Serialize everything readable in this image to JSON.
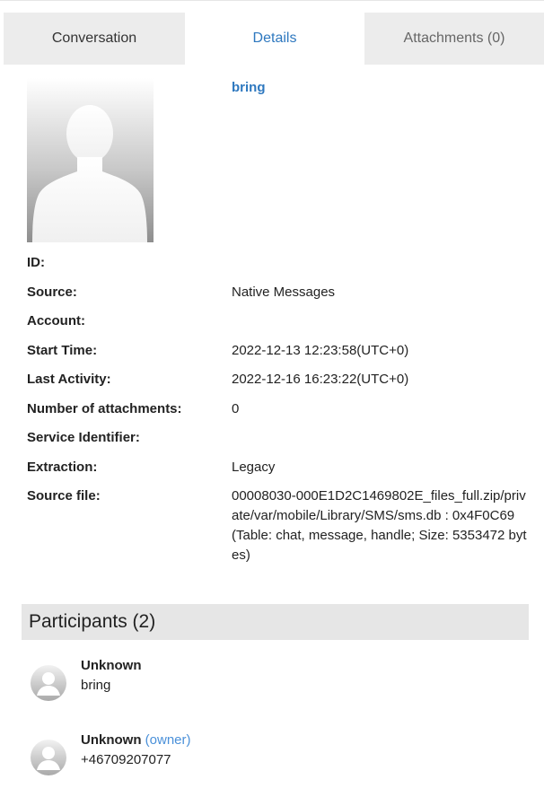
{
  "tabs": {
    "conversation": "Conversation",
    "details": "Details",
    "attachments": "Attachments (0)"
  },
  "conversation_title": "bring",
  "details": [
    {
      "label": "ID:",
      "value": ""
    },
    {
      "label": "Source:",
      "value": "Native Messages"
    },
    {
      "label": "Account:",
      "value": ""
    },
    {
      "label": "Start Time:",
      "value": "2022-12-13 12:23:58(UTC+0)"
    },
    {
      "label": "Last Activity:",
      "value": "2022-12-16 16:23:22(UTC+0)"
    },
    {
      "label": "Number of attachments:",
      "value": "0"
    },
    {
      "label": "Service Identifier:",
      "value": ""
    },
    {
      "label": "Extraction:",
      "value": "Legacy"
    },
    {
      "label": "Source file:",
      "value": "00008030-000E1D2C1469802E_files_full.zip/private/var/mobile/Library/SMS/sms.db : 0x4F0C69 (Table: chat, message, handle; Size: 5353472 bytes)"
    }
  ],
  "participants": {
    "header": "Participants (2)",
    "items": [
      {
        "name": "Unknown",
        "role": "",
        "identifier": "bring"
      },
      {
        "name": "Unknown",
        "role": "(owner)",
        "identifier": "+46709207077"
      }
    ]
  },
  "colors": {
    "accent": "#2e78bf",
    "owner": "#4a90d9",
    "tab_bg": "#ececec",
    "header_bg": "#e6e6e6"
  },
  "icons": {
    "avatar": "person-silhouette-icon",
    "participant": "person-avatar-icon"
  }
}
